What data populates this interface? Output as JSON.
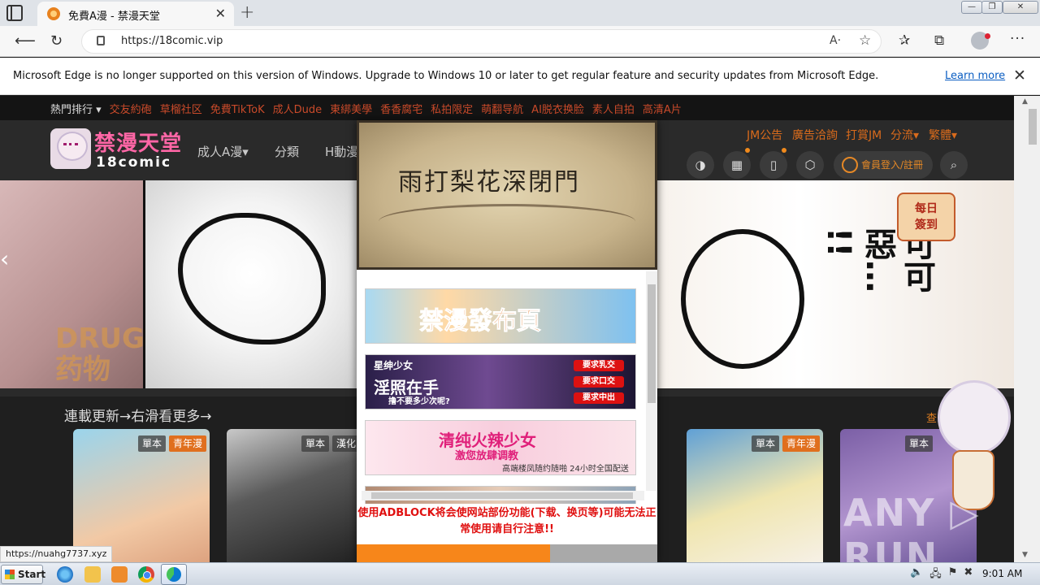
{
  "browser": {
    "tab_title": "免費A漫 - 禁漫天堂",
    "tab_close": "✕",
    "new_tab": "+",
    "url": "https://18comic.vip",
    "read_aloud": "A·",
    "window_controls": {
      "minimize": "—",
      "maximize": "❐",
      "close": "✕"
    },
    "icons": {
      "back": "arrow-left-icon",
      "reload": "reload-icon",
      "favorites": "favorites-icon",
      "collections": "collections-icon",
      "menu": "ellipsis-icon"
    }
  },
  "infobar": {
    "message": "Microsoft Edge is no longer supported on this version of Windows. Upgrade to Windows 10 or later to get regular feature and security updates from Microsoft Edge.",
    "learn_more": "Learn more",
    "close": "✕"
  },
  "site": {
    "hot_links": [
      "熱門排行 ▾",
      "交友約砲",
      "草榴社区",
      "免費TikToK",
      "成人Dude",
      "東綁美學",
      "香香腐宅",
      "私拍限定",
      "萌翻导航",
      "AI脱衣换脸",
      "素人自拍",
      "高清A片"
    ],
    "logo_text": "禁漫天堂",
    "logo_sub": "18comic",
    "nav": {
      "adult": "成人A漫▾",
      "categories": "分類",
      "h_anime": "H動漫"
    },
    "right_links": {
      "notice": "JM公告",
      "ad_contact": "廣告洽詢",
      "tip": "打賞JM",
      "diversion": "分流▾",
      "traditional": "繁體▾"
    },
    "login": "會員登入/註冊",
    "banner": {
      "left_caption": "DRUG\n药物",
      "manga_text": "可可\n惡…\n!!",
      "daily_checkin": "每日\n簽到"
    },
    "section_title": "連載更新→右滑看更多→",
    "more_link": "查",
    "card_tags": {
      "single": "單本",
      "youth": "青年漫",
      "chinese": "漢化"
    },
    "watermark": "ANY ▷ RUN"
  },
  "modal": {
    "title": "雨打梨花深閉門",
    "ads": {
      "ad1": "禁漫發布頁",
      "ad2_small": "星绅少女",
      "ad2_main": "淫照在手",
      "ad2_sub": "撸不要多少次呢?",
      "ad2_btn1": "要求乳交",
      "ad2_btn2": "要求口交",
      "ad2_btn3": "要求中出",
      "ad3_main": "清纯火辣少女",
      "ad3_sub": "激您放肆调教",
      "ad3_foot": "高端楼凤随约随啪 24小时全国配送"
    },
    "warning": "使用ADBLOCK将会使网站部份功能(下载、换页等)可能无法正常使用请自行注意!!"
  },
  "status_bar_url": "https://nuahg7737.xyz",
  "taskbar": {
    "start": "Start",
    "clock": "9:01 AM",
    "tray": [
      "🔈",
      "🖧",
      "⚑",
      "✖"
    ]
  }
}
